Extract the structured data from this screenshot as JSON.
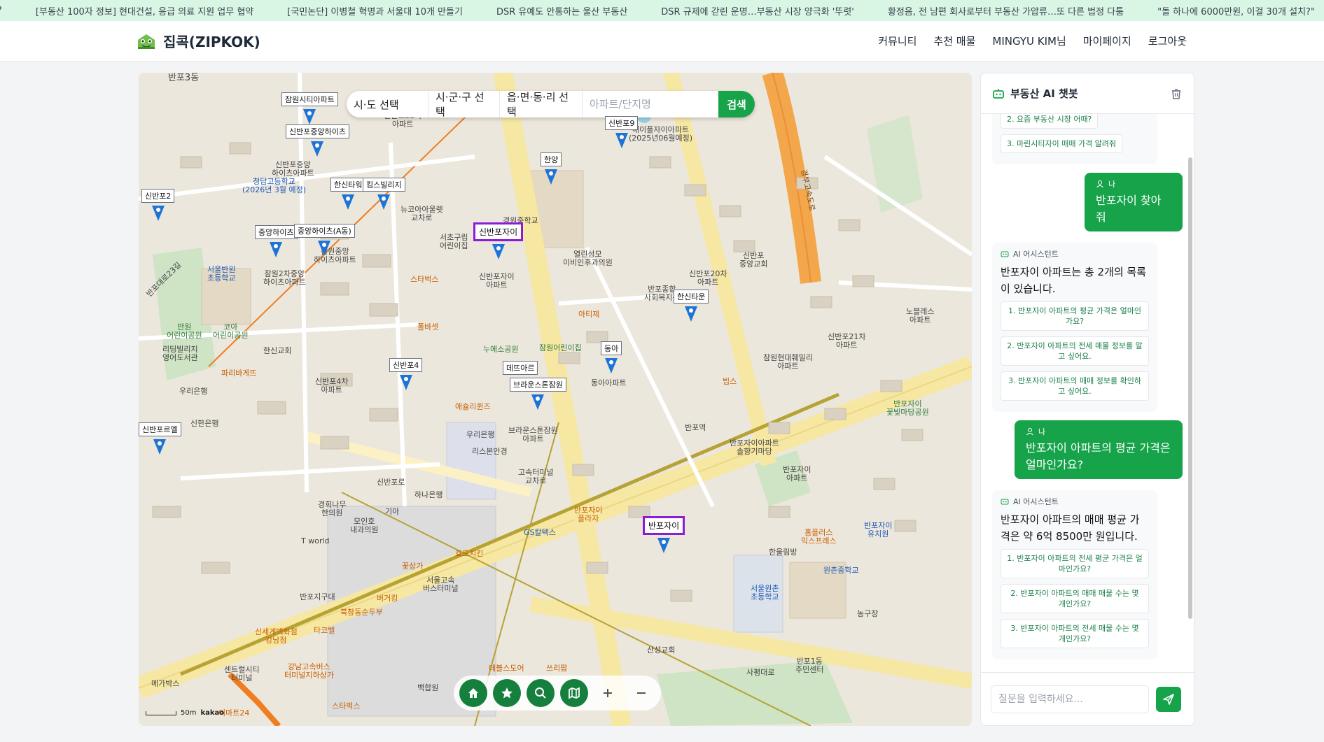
{
  "ticker": [
    "e?",
    "[부동산 100자 정보] 현대건설, 응급 의료 지원 업무 협약",
    "[국민논단] 이병철 혁명과 서울대 10개 만들기",
    "DSR 유예도 안통하는 울산 부동산",
    "DSR 규제에 갇린 운명…부동산 시장 양극화 '뚜렷'",
    "황정음, 전 남편 회사로부터 부동산 가압류…또 다른 법정 다툼",
    "\"돌 하나에 6000만원, 이걸 30개 설치?\""
  ],
  "header": {
    "logo_text": "집콕(ZIPKOK)",
    "nav": [
      "커뮤니티",
      "추천 매물",
      "MINGYU KIM님",
      "마이페이지",
      "로그아웃"
    ]
  },
  "search": {
    "sido": "시·도 선택",
    "sigungu": "시·군·구 선택",
    "eupmyeondong": "읍·면·동·리 선택",
    "placeholder": "아파트/단지명",
    "button": "검색"
  },
  "markers": [
    {
      "label": "잠원시티아파트"
    },
    {
      "label": "신반포중앙하이츠"
    },
    {
      "label": "한신타워"
    },
    {
      "label": "킴스빌리지"
    },
    {
      "label": "신반포2"
    },
    {
      "label": "중앙하이츠"
    },
    {
      "label": "중앙하이츠(A동)"
    },
    {
      "label": "한양"
    },
    {
      "label": "신반포9"
    },
    {
      "label": "신반포자이"
    },
    {
      "label": "한신타운"
    },
    {
      "label": "동아"
    },
    {
      "label": "데뜨아르"
    },
    {
      "label": "브라운스톤잠원"
    },
    {
      "label": "신반포4"
    },
    {
      "label": "신반포르엘"
    },
    {
      "label": "반포자이"
    }
  ],
  "map_labels": [
    "반포3동",
    "신반포22차\n아파트",
    "메이플자이아파트\n(2025년06월예정)",
    "청담고등학교\n(2026년 3월 예정)",
    "서울반원\n초등학교",
    "신반포중앙\n하이츠아파트",
    "잠원2차중앙\n하이츠아파트",
    "잠원중앙\n하이츠아파트",
    "스타벅스",
    "뉴코아아울렛\n교차로",
    "서초구립\n어린이집",
    "신반포자이\n아파트",
    "경원중학교",
    "열린성모\n이비인후과의원",
    "반포종합\n사회복지관",
    "신반포20차\n아파트",
    "신반포\n중앙교회",
    "폴바셋",
    "아티제",
    "누에소공원",
    "잠원어린이집",
    "신반포21차\n아파트",
    "잠원현대훼밀리\n아파트",
    "반원\n어린이공원",
    "리딩빌리지\n영어도서관",
    "코아\n어린이공원",
    "한신교회",
    "파리바게뜨",
    "우리은행",
    "신반포4차\n아파트",
    "신한은행",
    "애슐리퀸즈",
    "우리은행",
    "브라운스톤잠원\n아파트",
    "리스본안경",
    "동아아파트",
    "빕스",
    "반포역",
    "반포자이아파트\n솔향기마당",
    "반포자이\n아파트",
    "노블레스\n아파트",
    "반포자이\n꽃빛마당공원",
    "고속터미널\n교차로",
    "하나은행",
    "경희나무\n한의원",
    "기아",
    "모인호\n내과의원",
    "GS칼텍스",
    "반포자이\n플라자",
    "효도치킨",
    "홈플러스\n익스프레스",
    "반포자이\n유치원",
    "한울림방",
    "원촌중학교",
    "서울원촌\n초등학교",
    "농구장",
    "T world",
    "꽃상가",
    "서울고속\n버스터미널",
    "버거킹",
    "반포지구대",
    "북창동순두부",
    "타코벨",
    "신세계백화점\n강남점",
    "센트럴시티\n터미널",
    "강남고속버스\n터미널지하상가",
    "메가박스",
    "데블스도어",
    "쓰리팝",
    "백합원",
    "산성교회",
    "반포1동\n주민센터",
    "사평대로",
    "이마트24",
    "스타벅스",
    "경부고속도로",
    "반포대로23길",
    "신반포로"
  ],
  "map_controls": [
    "home-icon",
    "star-icon",
    "search-icon",
    "map-icon",
    "zoom-in-icon",
    "zoom-out-icon"
  ],
  "scale_text": "50m",
  "kakao_text": "kakao",
  "chat": {
    "title": "부동산 AI 챗봇",
    "partial_suggestions": [
      "2. 요즘 부동산 시장 어때?",
      "3. 마린시티자이 매매 가격 알려줘"
    ],
    "messages": [
      {
        "role": "me",
        "tag": "나",
        "text": "반포자이 찾아줘"
      },
      {
        "role": "ai",
        "tag": "AI 어시스턴트",
        "text": "반포자이 아파트는 총 2개의 목록이 있습니다.",
        "suggestions": [
          "1. 반포자이 아파트의 평균 가격은 얼마인가요?",
          "2. 반포자이 아파트의 전세 매물 정보를 알고 싶어요.",
          "3. 반포자이 아파트의 매매 정보를 확인하고 싶어요."
        ]
      },
      {
        "role": "me",
        "tag": "나",
        "text": "반포자이 아파트의 평균 가격은 얼마인가요?"
      },
      {
        "role": "ai",
        "tag": "AI 어시스턴트",
        "text": "반포자이 아파트의 매매 평균 가격은 약 6억 8500만 원입니다.",
        "suggestions": [
          "1. 반포자이 아파트의 전세 평균 가격은 얼마인가요?",
          "2. 반포자이 아파트의 매매 매물 수는 몇 개인가요?",
          "3. 반포자이 아파트의 전세 매물 수는 몇 개인가요?"
        ]
      }
    ],
    "input_placeholder": "질문을 입력하세요..."
  },
  "colors": {
    "brand": "#16a34a",
    "highlight": "#8b1dd6",
    "pin": "#1e74d6",
    "ticker_bg": "#d9f5e3"
  }
}
